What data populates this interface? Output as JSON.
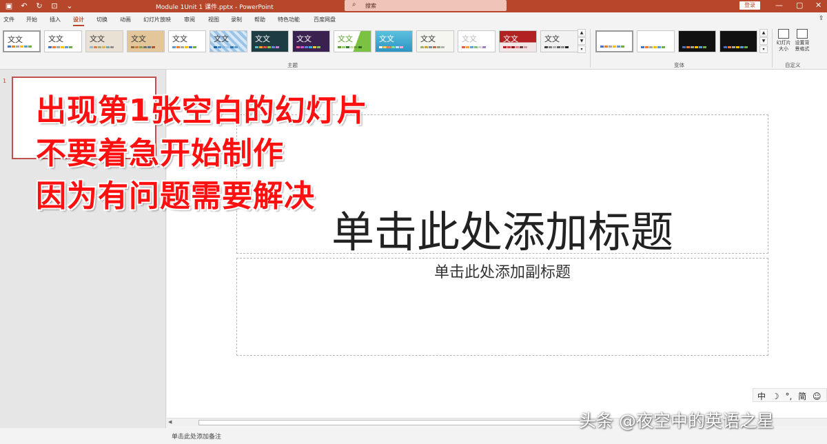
{
  "window": {
    "title": "Module 1Unit 1 课件.pptx  -  PowerPoint",
    "search_placeholder": "搜索",
    "login_label": "登录",
    "minimize": "—",
    "restore": "▢",
    "close": "✕"
  },
  "tabs": [
    {
      "label": "文件"
    },
    {
      "label": "开始"
    },
    {
      "label": "插入"
    },
    {
      "label": "设计"
    },
    {
      "label": "切换"
    },
    {
      "label": "动画"
    },
    {
      "label": "幻灯片放映"
    },
    {
      "label": "审阅"
    },
    {
      "label": "视图"
    },
    {
      "label": "录制"
    },
    {
      "label": "帮助"
    },
    {
      "label": "特色功能"
    },
    {
      "label": "百度网盘"
    }
  ],
  "ribbon": {
    "themes_group_label": "主题",
    "variants_group_label": "变体",
    "customize_group_label": "自定义",
    "theme_sample_text": "文文",
    "slide_size_label": "幻灯片大小",
    "format_bg_label": "设置背景格式"
  },
  "thumbnails": {
    "slide_number": "1"
  },
  "slide": {
    "title_placeholder": "单击此处添加标题",
    "subtitle_placeholder": "单击此处添加副标题"
  },
  "annotation": {
    "line1": "出现第1张空白的幻灯片",
    "line2": "不要着急开始制作",
    "line3": "因为有问题需要解决"
  },
  "ime": {
    "mode": "中",
    "moon": "☽",
    "punct": "°,",
    "simplified": "简",
    "emoji": "☺"
  },
  "notes": {
    "placeholder": "单击此处添加备注"
  },
  "watermark": "头条 @夜空中的英语之星",
  "colors": {
    "accent": "#b7472a",
    "annotation_red": "#ff1010"
  }
}
